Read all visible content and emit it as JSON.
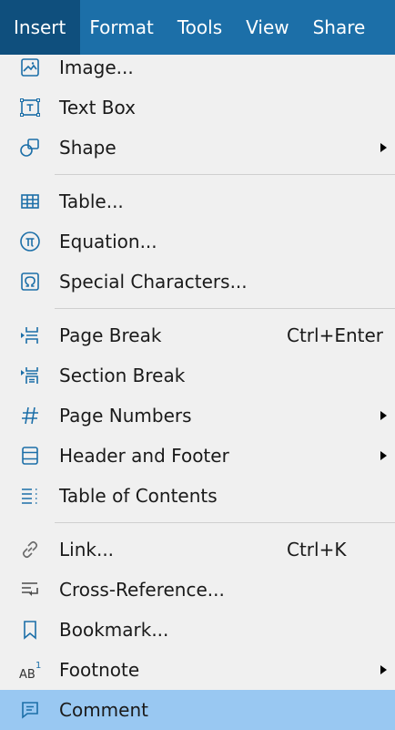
{
  "menubar": {
    "items": [
      {
        "label": "Insert"
      },
      {
        "label": "Format"
      },
      {
        "label": "Tools"
      },
      {
        "label": "View"
      },
      {
        "label": "Share"
      }
    ]
  },
  "menu": {
    "group1": [
      {
        "label": "Image...",
        "icon": "image-icon"
      },
      {
        "label": "Text Box",
        "icon": "text-box-icon"
      },
      {
        "label": "Shape",
        "icon": "shape-icon",
        "submenu": true
      }
    ],
    "group2": [
      {
        "label": "Table...",
        "icon": "table-icon"
      },
      {
        "label": "Equation...",
        "icon": "pi-icon"
      },
      {
        "label": "Special Characters...",
        "icon": "omega-icon"
      }
    ],
    "group3": [
      {
        "label": "Page Break",
        "icon": "page-break-icon",
        "shortcut": "Ctrl+Enter"
      },
      {
        "label": "Section Break",
        "icon": "section-break-icon"
      },
      {
        "label": "Page Numbers",
        "icon": "hash-icon",
        "submenu": true
      },
      {
        "label": "Header and Footer",
        "icon": "header-footer-icon",
        "submenu": true
      },
      {
        "label": "Table of Contents",
        "icon": "toc-icon"
      }
    ],
    "group4": [
      {
        "label": "Link...",
        "icon": "link-icon",
        "shortcut": "Ctrl+K"
      },
      {
        "label": "Cross-Reference...",
        "icon": "cross-reference-icon"
      },
      {
        "label": "Bookmark...",
        "icon": "bookmark-icon"
      },
      {
        "label": "Footnote",
        "icon": "footnote-icon",
        "submenu": true
      },
      {
        "label": "Comment",
        "icon": "comment-icon",
        "highlighted": true
      }
    ]
  },
  "colors": {
    "accent": "#1c6fa8",
    "highlight": "#99c8f2",
    "background": "#f0f0f0"
  }
}
